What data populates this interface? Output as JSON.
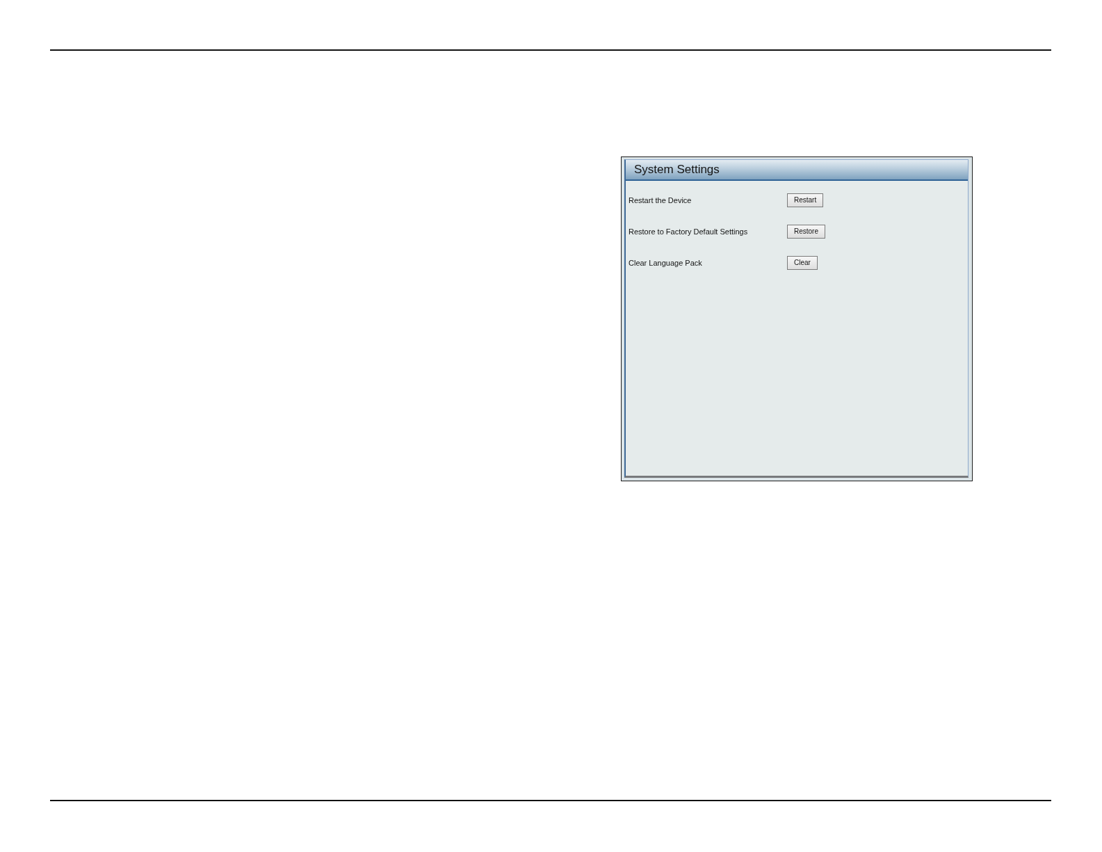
{
  "panel": {
    "title": "System Settings",
    "rows": [
      {
        "label": "Restart the Device",
        "button": "Restart"
      },
      {
        "label": "Restore to Factory Default Settings",
        "button": "Restore"
      },
      {
        "label": "Clear Language Pack",
        "button": "Clear"
      }
    ]
  }
}
